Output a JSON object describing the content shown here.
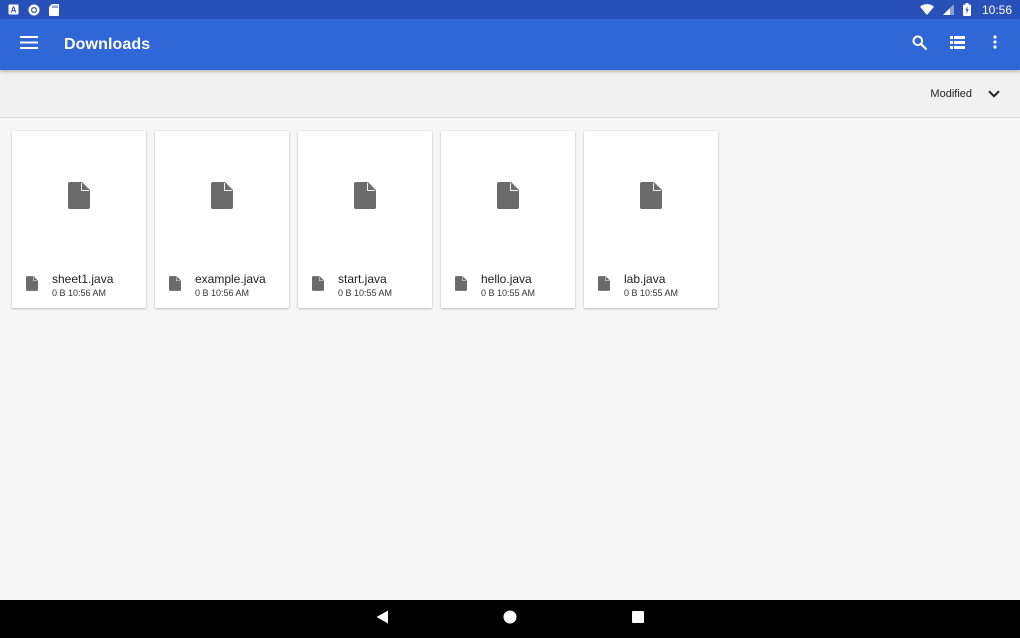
{
  "status_bar": {
    "time": "10:56",
    "left_icons": [
      "a-badge-icon",
      "circle-notification-icon",
      "sd-card-icon"
    ],
    "right_icons": [
      "wifi-icon",
      "signal-icon",
      "battery-icon"
    ]
  },
  "app_bar": {
    "title": "Downloads",
    "color": "#3067d6",
    "icons": [
      "menu-icon",
      "search-icon",
      "list-view-icon",
      "more-vert-icon"
    ]
  },
  "sort_bar": {
    "label": "Modified",
    "icon": "chevron-down-icon"
  },
  "files": [
    {
      "name": "sheet1.java",
      "meta": "0 B 10:56 AM"
    },
    {
      "name": "example.java",
      "meta": "0 B 10:56 AM"
    },
    {
      "name": "start.java",
      "meta": "0 B 10:55 AM"
    },
    {
      "name": "hello.java",
      "meta": "0 B 10:55 AM"
    },
    {
      "name": "lab.java",
      "meta": "0 B 10:55 AM"
    }
  ],
  "nav_bar": {
    "icons": [
      "back-icon",
      "home-icon",
      "recents-icon"
    ]
  }
}
